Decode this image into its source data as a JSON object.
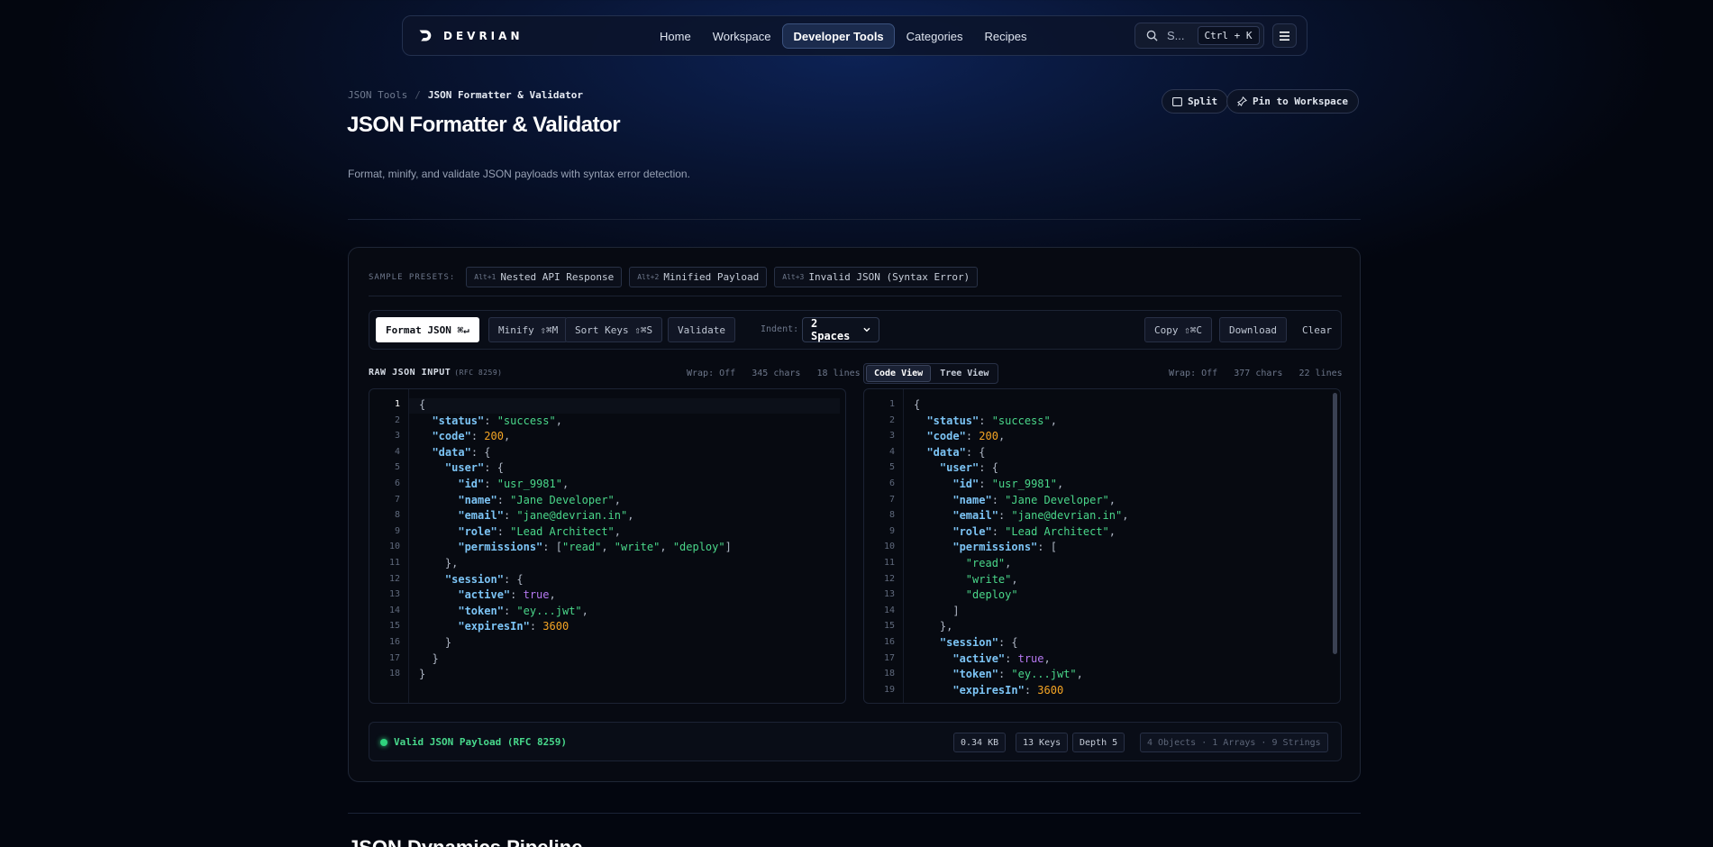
{
  "brand": {
    "name": "DEVRIAN"
  },
  "nav": {
    "links": [
      "Home",
      "Workspace",
      "Developer Tools",
      "Categories",
      "Recipes"
    ],
    "active": "Developer Tools",
    "search_text": "S...",
    "search_shortcut": "Ctrl + K"
  },
  "header": {
    "breadcrumb_parent": "JSON Tools",
    "breadcrumb_sep": "/",
    "breadcrumb_current": "JSON Formatter & Validator",
    "title": "JSON Formatter & Validator",
    "description": "Format, minify, and validate JSON payloads with syntax error detection.",
    "split_label": "Split",
    "pin_label": "Pin to Workspace"
  },
  "presets": {
    "label": "SAMPLE PRESETS:",
    "items": [
      {
        "key": "Alt+1",
        "label": "Nested API Response"
      },
      {
        "key": "Alt+2",
        "label": "Minified Payload"
      },
      {
        "key": "Alt+3",
        "label": "Invalid JSON (Syntax Error)"
      }
    ]
  },
  "toolbar": {
    "format": "Format JSON ⌘↵",
    "minify": "Minify ⇧⌘M",
    "sort": "Sort Keys ⇧⌘S",
    "validate": "Validate",
    "indent_label": "Indent:",
    "indent_value": "2 Spaces",
    "copy": "Copy ⇧⌘C",
    "download": "Download",
    "clear": "Clear"
  },
  "input_editor": {
    "title": "RAW JSON INPUT",
    "subtitle": "(RFC 8259)",
    "meta": "Wrap: Off   345 chars   18 lines",
    "lines": [
      [
        [
          "p",
          "{"
        ]
      ],
      [
        [
          "p",
          "  "
        ],
        [
          "k",
          "\"status\""
        ],
        [
          "p",
          ": "
        ],
        [
          "s",
          "\"success\""
        ],
        [
          "p",
          ","
        ]
      ],
      [
        [
          "p",
          "  "
        ],
        [
          "k",
          "\"code\""
        ],
        [
          "p",
          ": "
        ],
        [
          "n",
          "200"
        ],
        [
          "p",
          ","
        ]
      ],
      [
        [
          "p",
          "  "
        ],
        [
          "k",
          "\"data\""
        ],
        [
          "p",
          ": {"
        ]
      ],
      [
        [
          "p",
          "    "
        ],
        [
          "k",
          "\"user\""
        ],
        [
          "p",
          ": {"
        ]
      ],
      [
        [
          "p",
          "      "
        ],
        [
          "k",
          "\"id\""
        ],
        [
          "p",
          ": "
        ],
        [
          "s",
          "\"usr_9981\""
        ],
        [
          "p",
          ","
        ]
      ],
      [
        [
          "p",
          "      "
        ],
        [
          "k",
          "\"name\""
        ],
        [
          "p",
          ": "
        ],
        [
          "s",
          "\"Jane Developer\""
        ],
        [
          "p",
          ","
        ]
      ],
      [
        [
          "p",
          "      "
        ],
        [
          "k",
          "\"email\""
        ],
        [
          "p",
          ": "
        ],
        [
          "s",
          "\"jane@devrian.in\""
        ],
        [
          "p",
          ","
        ]
      ],
      [
        [
          "p",
          "      "
        ],
        [
          "k",
          "\"role\""
        ],
        [
          "p",
          ": "
        ],
        [
          "s",
          "\"Lead Architect\""
        ],
        [
          "p",
          ","
        ]
      ],
      [
        [
          "p",
          "      "
        ],
        [
          "k",
          "\"permissions\""
        ],
        [
          "p",
          ": ["
        ],
        [
          "s",
          "\"read\""
        ],
        [
          "p",
          ", "
        ],
        [
          "s",
          "\"write\""
        ],
        [
          "p",
          ", "
        ],
        [
          "s",
          "\"deploy\""
        ],
        [
          "p",
          "]"
        ]
      ],
      [
        [
          "p",
          "    },"
        ]
      ],
      [
        [
          "p",
          "    "
        ],
        [
          "k",
          "\"session\""
        ],
        [
          "p",
          ": {"
        ]
      ],
      [
        [
          "p",
          "      "
        ],
        [
          "k",
          "\"active\""
        ],
        [
          "p",
          ": "
        ],
        [
          "b",
          "true"
        ],
        [
          "p",
          ","
        ]
      ],
      [
        [
          "p",
          "      "
        ],
        [
          "k",
          "\"token\""
        ],
        [
          "p",
          ": "
        ],
        [
          "s",
          "\"ey...jwt\""
        ],
        [
          "p",
          ","
        ]
      ],
      [
        [
          "p",
          "      "
        ],
        [
          "k",
          "\"expiresIn\""
        ],
        [
          "p",
          ": "
        ],
        [
          "n",
          "3600"
        ]
      ],
      [
        [
          "p",
          "    }"
        ]
      ],
      [
        [
          "p",
          "  }"
        ]
      ],
      [
        [
          "p",
          "}"
        ]
      ]
    ]
  },
  "output_editor": {
    "tabs": [
      "Code View",
      "Tree View"
    ],
    "active_tab": "Code View",
    "meta": "Wrap: Off   377 chars   22 lines",
    "lines": [
      [
        [
          "p",
          "{"
        ]
      ],
      [
        [
          "p",
          "  "
        ],
        [
          "k",
          "\"status\""
        ],
        [
          "p",
          ": "
        ],
        [
          "s",
          "\"success\""
        ],
        [
          "p",
          ","
        ]
      ],
      [
        [
          "p",
          "  "
        ],
        [
          "k",
          "\"code\""
        ],
        [
          "p",
          ": "
        ],
        [
          "n",
          "200"
        ],
        [
          "p",
          ","
        ]
      ],
      [
        [
          "p",
          "  "
        ],
        [
          "k",
          "\"data\""
        ],
        [
          "p",
          ": {"
        ]
      ],
      [
        [
          "p",
          "    "
        ],
        [
          "k",
          "\"user\""
        ],
        [
          "p",
          ": {"
        ]
      ],
      [
        [
          "p",
          "      "
        ],
        [
          "k",
          "\"id\""
        ],
        [
          "p",
          ": "
        ],
        [
          "s",
          "\"usr_9981\""
        ],
        [
          "p",
          ","
        ]
      ],
      [
        [
          "p",
          "      "
        ],
        [
          "k",
          "\"name\""
        ],
        [
          "p",
          ": "
        ],
        [
          "s",
          "\"Jane Developer\""
        ],
        [
          "p",
          ","
        ]
      ],
      [
        [
          "p",
          "      "
        ],
        [
          "k",
          "\"email\""
        ],
        [
          "p",
          ": "
        ],
        [
          "s",
          "\"jane@devrian.in\""
        ],
        [
          "p",
          ","
        ]
      ],
      [
        [
          "p",
          "      "
        ],
        [
          "k",
          "\"role\""
        ],
        [
          "p",
          ": "
        ],
        [
          "s",
          "\"Lead Architect\""
        ],
        [
          "p",
          ","
        ]
      ],
      [
        [
          "p",
          "      "
        ],
        [
          "k",
          "\"permissions\""
        ],
        [
          "p",
          ": ["
        ]
      ],
      [
        [
          "p",
          "        "
        ],
        [
          "s",
          "\"read\""
        ],
        [
          "p",
          ","
        ]
      ],
      [
        [
          "p",
          "        "
        ],
        [
          "s",
          "\"write\""
        ],
        [
          "p",
          ","
        ]
      ],
      [
        [
          "p",
          "        "
        ],
        [
          "s",
          "\"deploy\""
        ]
      ],
      [
        [
          "p",
          "      ]"
        ]
      ],
      [
        [
          "p",
          "    },"
        ]
      ],
      [
        [
          "p",
          "    "
        ],
        [
          "k",
          "\"session\""
        ],
        [
          "p",
          ": {"
        ]
      ],
      [
        [
          "p",
          "      "
        ],
        [
          "k",
          "\"active\""
        ],
        [
          "p",
          ": "
        ],
        [
          "b",
          "true"
        ],
        [
          "p",
          ","
        ]
      ],
      [
        [
          "p",
          "      "
        ],
        [
          "k",
          "\"token\""
        ],
        [
          "p",
          ": "
        ],
        [
          "s",
          "\"ey...jwt\""
        ],
        [
          "p",
          ","
        ]
      ],
      [
        [
          "p",
          "      "
        ],
        [
          "k",
          "\"expiresIn\""
        ],
        [
          "p",
          ": "
        ],
        [
          "n",
          "3600"
        ]
      ]
    ]
  },
  "status": {
    "text": "Valid JSON Payload (RFC 8259)",
    "size": "0.34 KB",
    "keys": "13 Keys",
    "depth": "Depth 5",
    "summary": "4 Objects · 1 Arrays · 9 Strings"
  },
  "next_section_title": "JSON Dynamics Pipeline",
  "colors": {
    "accent_green": "#2fd37d",
    "key": "#7cc4f5",
    "string": "#4ad78a",
    "number": "#f5a524",
    "boolean": "#b679f2"
  }
}
